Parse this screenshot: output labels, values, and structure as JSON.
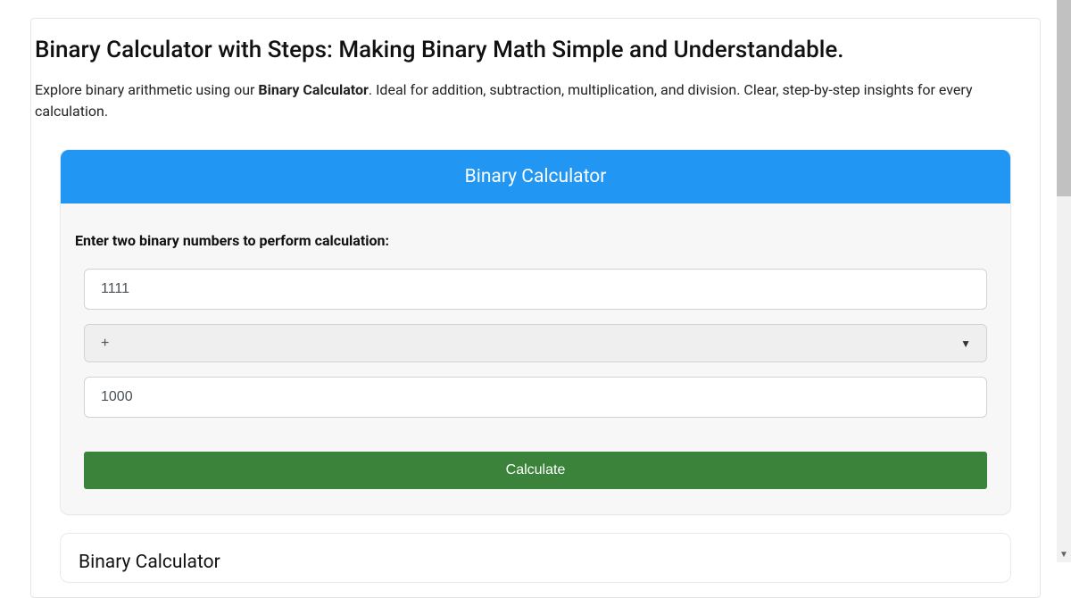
{
  "header": {
    "title": "Binary Calculator with Steps: Making Binary Math Simple and Understandable.",
    "subtitle_prefix": "Explore binary arithmetic using our ",
    "subtitle_bold": "Binary Calculator",
    "subtitle_suffix": ". Ideal for addition, subtraction, multiplication, and division. Clear, step-by-step insights for every calculation."
  },
  "calculator": {
    "card_title": "Binary Calculator",
    "instruction": "Enter two binary numbers to perform calculation:",
    "input1_value": "1111",
    "operator_selected": "+",
    "input2_value": "1000",
    "button_label": "Calculate"
  },
  "result": {
    "title": "Binary Calculator"
  },
  "colors": {
    "header_bg": "#2196f3",
    "button_bg": "#3b833b"
  }
}
